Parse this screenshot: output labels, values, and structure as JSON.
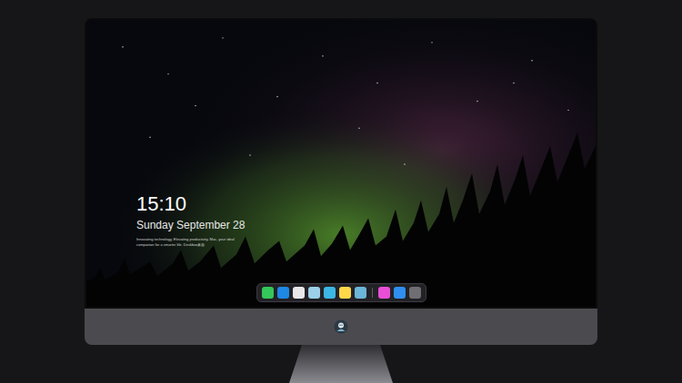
{
  "desktop": {
    "time": "15:10",
    "date": "Sunday September 28",
    "tagline": "Innovating technology, Elevating productivity. Mac, your ideal companion for a smarter life. Deskbox桌面"
  },
  "dock": {
    "apps": [
      {
        "color": "#34c759"
      },
      {
        "color": "#1e88e5"
      },
      {
        "color": "#e8e8ea"
      },
      {
        "color": "#9ccfe8"
      },
      {
        "color": "#3db7e4"
      },
      {
        "color": "#ffd84a"
      },
      {
        "color": "#6cb6d9"
      }
    ],
    "pinned": [
      {
        "color": "#e84fd6"
      },
      {
        "color": "#2f8ff0"
      },
      {
        "color": "#6e6e73"
      }
    ]
  }
}
